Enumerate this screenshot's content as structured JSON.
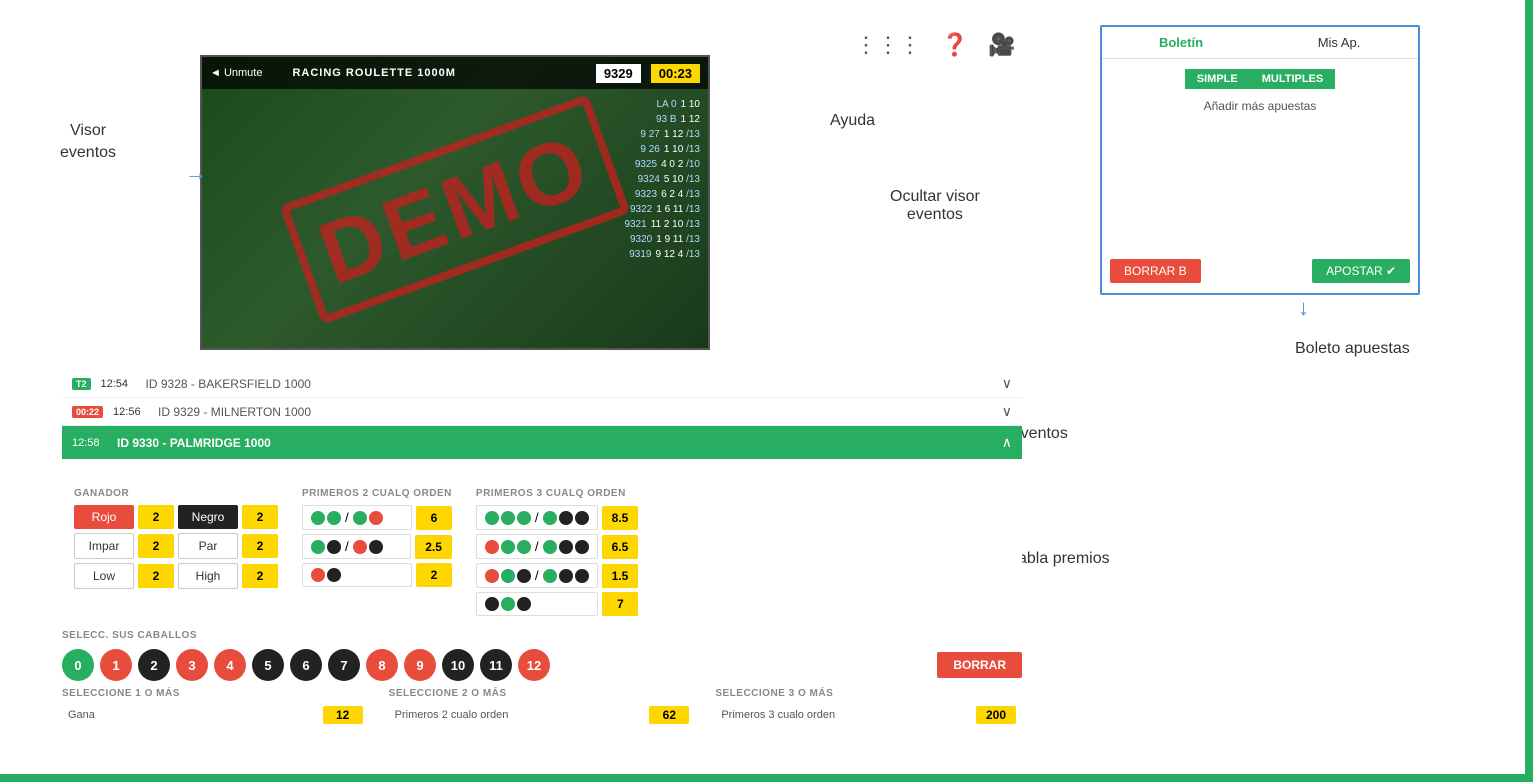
{
  "annotations": {
    "visor_eventos": "Visor\neventos",
    "ayuda": "Ayuda",
    "ocultar_visor": "Ocultar visor\neventos",
    "boleto_apuestas": "Boleto apuestas",
    "eventos": "Eventos",
    "tabla_premios": "Tabla premios"
  },
  "video": {
    "unmute": "◄ Unmute",
    "game_title": "RACING ROULETTE 1000M",
    "game_id": "9329",
    "timer": "00:23",
    "demo": "DEMO",
    "race_rows": [
      {
        "id": "LA  0",
        "vals": "1  10"
      },
      {
        "id": "93 B",
        "vals": "1  12"
      },
      {
        "id": "9 27",
        "vals": "1  12 /13"
      },
      {
        "id": "9 26",
        "vals": "1  10 /13"
      },
      {
        "id": "9325",
        "vals": "4  0  2  /10"
      },
      {
        "id": "9324",
        "vals": "",
        "vals2": "5  10 /13"
      },
      {
        "id": "9323",
        "vals": "6  2  4  /13"
      },
      {
        "id": "9322",
        "vals": "1  6  11 /13"
      },
      {
        "id": "9321",
        "vals": "11 2  10 /13"
      },
      {
        "id": "9320",
        "vals": "1  9  11 /13"
      },
      {
        "id": "9319",
        "vals": "9  12 4  /13"
      }
    ]
  },
  "boleto": {
    "tab1": "Boletín",
    "tab2": "Mis Ap.",
    "toggle1": "SIMPLE",
    "toggle2": "MULTIPLES",
    "add_text": "Añadir más apuestas",
    "btn_borrar": "BORRAR B",
    "btn_apostar": "APOSTAR ✔"
  },
  "events": [
    {
      "badge": "T2",
      "badge_color": "green",
      "time": "12:54",
      "name": "ID 9328 - BAKERSFIELD 1000",
      "active": false
    },
    {
      "badge": "00:22",
      "badge_color": "red",
      "time": "12:56",
      "name": "ID 9329 - MILNERTON 1000",
      "active": false
    },
    {
      "badge": "",
      "badge_color": "",
      "time": "12:58",
      "name": "ID 9330 - PALMRIDGE 1000",
      "active": true
    }
  ],
  "ganador": {
    "title": "GANADOR",
    "rows": [
      {
        "label1": "Rojo",
        "odds1": "2",
        "label2": "Negro",
        "odds2": "2"
      },
      {
        "label1": "Impar",
        "odds1": "2",
        "label2": "Par",
        "odds2": "2"
      },
      {
        "label1": "Low",
        "odds1": "2",
        "label2": "High",
        "odds2": "2"
      }
    ]
  },
  "primeros2": {
    "title": "PRIMEROS 2 CUALQ ORDEN",
    "rows": [
      {
        "circles": "green,green,slash,green,red",
        "odds": "6"
      },
      {
        "circles": "green,black,slash,red,black",
        "odds": "2.5"
      },
      {
        "circles": "red,black",
        "odds": "2"
      }
    ]
  },
  "primeros3": {
    "title": "PRIMEROS 3 CUALQ ORDEN",
    "rows": [
      {
        "circles": "green,green,green,slash,green,black,black",
        "odds": "8.5"
      },
      {
        "circles": "red,green,green,slash,green,black,black",
        "odds": "6.5"
      },
      {
        "circles": "red,green,black,slash,green,black,black",
        "odds": "1.5"
      },
      {
        "circles": "black,green,black",
        "odds": "7"
      }
    ]
  },
  "horses": {
    "title": "SELECC. SUS CABALLOS",
    "numbers": [
      {
        "num": "0",
        "color": "green"
      },
      {
        "num": "1",
        "color": "red"
      },
      {
        "num": "2",
        "color": "black"
      },
      {
        "num": "3",
        "color": "red"
      },
      {
        "num": "4",
        "color": "red"
      },
      {
        "num": "5",
        "color": "black"
      },
      {
        "num": "6",
        "color": "black"
      },
      {
        "num": "7",
        "color": "black"
      },
      {
        "num": "8",
        "color": "red"
      },
      {
        "num": "9",
        "color": "red"
      },
      {
        "num": "10",
        "color": "black"
      },
      {
        "num": "11",
        "color": "black"
      },
      {
        "num": "12",
        "color": "red"
      }
    ],
    "btn_borrar": "BORRAR"
  },
  "selection": {
    "col1": {
      "title": "SELECCIONE 1 O MÁS",
      "label": "Gana",
      "value": "12"
    },
    "col2": {
      "title": "SELECCIONE 2 O MÁS",
      "label": "Primeros 2 cualo orden",
      "value": "62"
    },
    "col3": {
      "title": "SELECCIONE 3 O MÁS",
      "label": "Primeros 3 cualo orden",
      "value": "200"
    }
  }
}
